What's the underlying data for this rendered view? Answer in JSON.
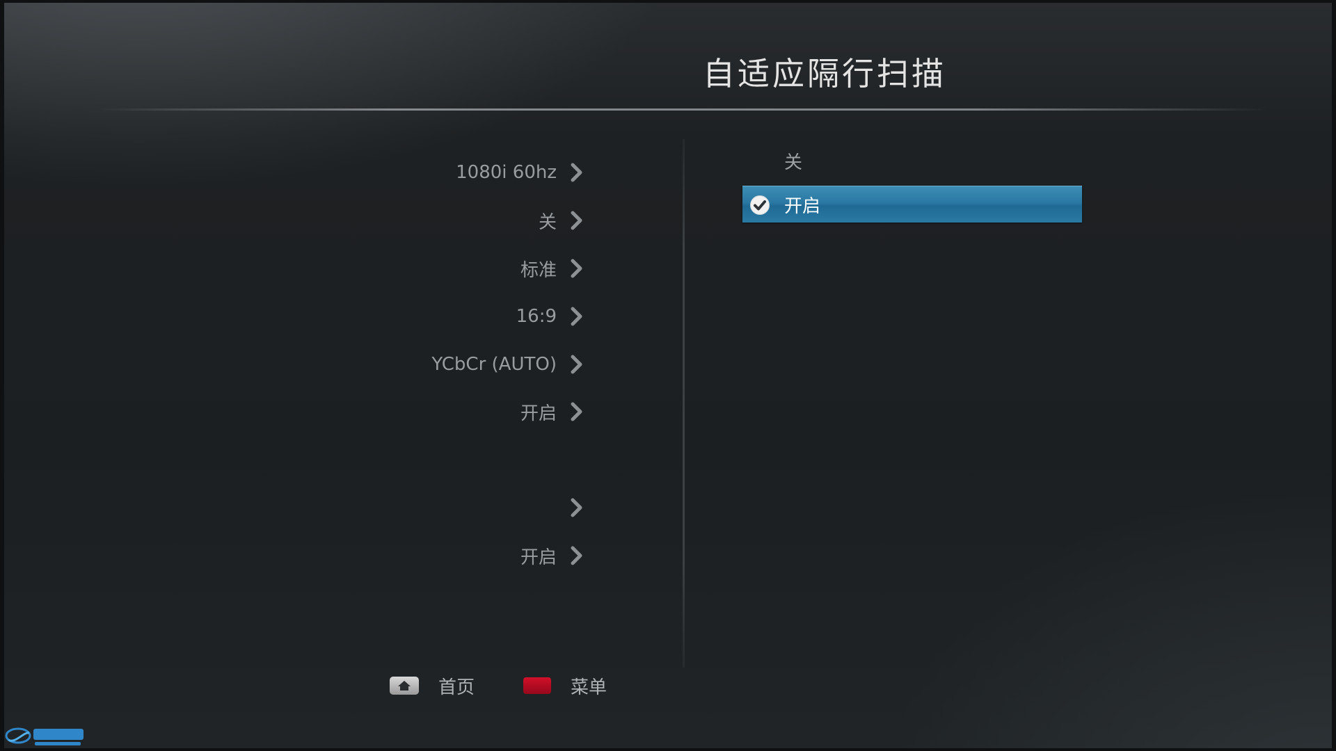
{
  "header": {
    "title": "自适应隔行扫描"
  },
  "settings": {
    "rows": [
      {
        "value": "1080i 60hz"
      },
      {
        "value": "关"
      },
      {
        "value": "标准"
      },
      {
        "value": "16:9"
      },
      {
        "value": "YCbCr (AUTO)"
      },
      {
        "value": "开启"
      },
      {
        "value": ""
      },
      {
        "value": ""
      },
      {
        "value": "开启"
      }
    ],
    "icon": "chevron-right-icon"
  },
  "options": {
    "items": [
      {
        "label": "关",
        "selected": false
      },
      {
        "label": "开启",
        "selected": true
      }
    ],
    "selected_icon": "check-circle-icon",
    "highlight_color": "#2a78a3"
  },
  "footer": {
    "home_label": "首页",
    "home_icon": "home-icon",
    "menu_label": "菜单",
    "menu_key_color": "#c00f26"
  },
  "watermark": {
    "name": "watermark-logo"
  }
}
